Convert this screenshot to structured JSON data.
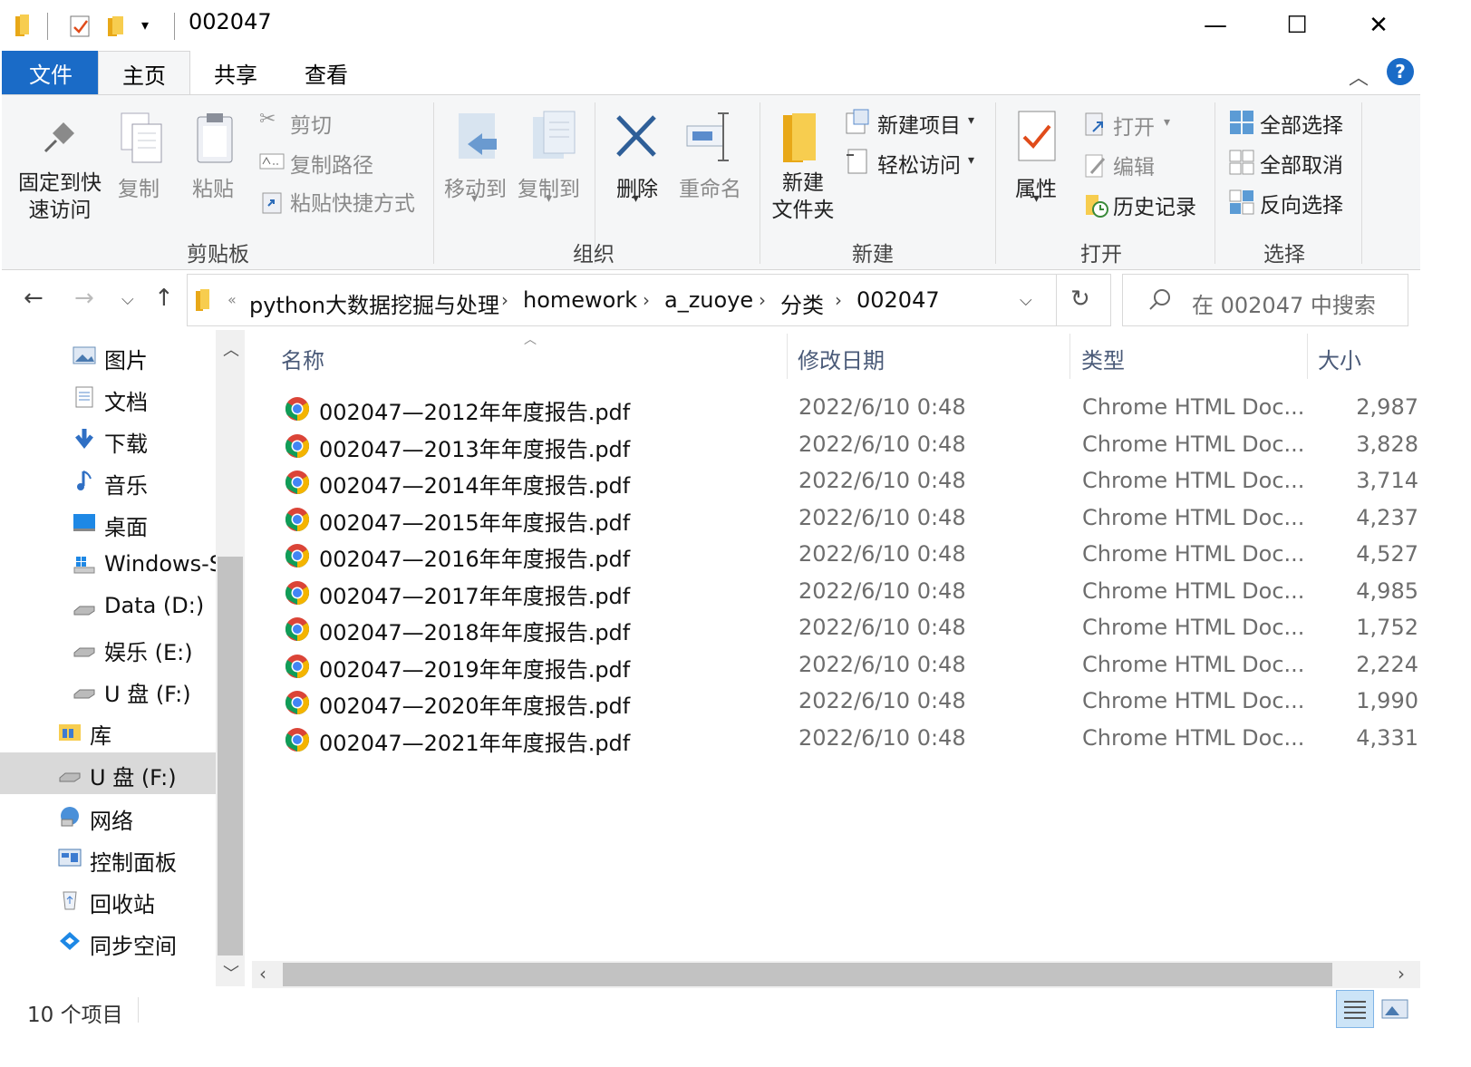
{
  "window": {
    "title": "002047",
    "controls": {
      "minimize": "—",
      "maximize": "☐",
      "close": "✕"
    }
  },
  "tabs": {
    "file": "文件",
    "home": "主页",
    "share": "共享",
    "view": "查看"
  },
  "ribbon": {
    "clipboard": {
      "pin": "固定到快\n速访问",
      "pin_l1": "固定到快",
      "pin_l2": "速访问",
      "copy": "复制",
      "paste": "粘贴",
      "cut": "剪切",
      "copy_path": "复制路径",
      "paste_shortcut": "粘贴快捷方式",
      "group": "剪贴板"
    },
    "organize": {
      "move_to": "移动到",
      "copy_to": "复制到",
      "delete": "删除",
      "rename": "重命名",
      "group": "组织"
    },
    "new": {
      "new_folder_l1": "新建",
      "new_folder_l2": "文件夹",
      "new_item": "新建项目",
      "easy_access": "轻松访问",
      "group": "新建"
    },
    "open": {
      "properties": "属性",
      "open": "打开",
      "edit": "编辑",
      "history": "历史记录",
      "group": "打开"
    },
    "select": {
      "select_all": "全部选择",
      "select_none": "全部取消",
      "invert": "反向选择",
      "group": "选择"
    }
  },
  "address": {
    "breadcrumbs": [
      "python大数据挖掘与处理",
      "homework",
      "a_zuoye",
      "分类",
      "002047"
    ],
    "search_placeholder": "在 002047 中搜索"
  },
  "nav_pane": {
    "items": [
      {
        "label": "图片",
        "icon": "pictures-icon"
      },
      {
        "label": "文档",
        "icon": "documents-icon"
      },
      {
        "label": "下载",
        "icon": "downloads-icon"
      },
      {
        "label": "音乐",
        "icon": "music-icon"
      },
      {
        "label": "桌面",
        "icon": "desktop-icon"
      },
      {
        "label": "Windows-S",
        "icon": "windows-drive-icon"
      },
      {
        "label": "Data (D:)",
        "icon": "drive-icon"
      },
      {
        "label": "娱乐 (E:)",
        "icon": "drive-icon"
      },
      {
        "label": "U 盘 (F:)",
        "icon": "usb-drive-icon"
      },
      {
        "label": "库",
        "icon": "library-icon"
      },
      {
        "label": "U 盘 (F:)",
        "icon": "usb-drive-icon"
      },
      {
        "label": "网络",
        "icon": "network-icon"
      },
      {
        "label": "控制面板",
        "icon": "control-panel-icon"
      },
      {
        "label": "回收站",
        "icon": "recycle-bin-icon"
      },
      {
        "label": "同步空间",
        "icon": "sync-space-icon"
      }
    ]
  },
  "file_list": {
    "columns": {
      "name": "名称",
      "date": "修改日期",
      "type": "类型",
      "size": "大小"
    },
    "rows": [
      {
        "name": "002047—2012年年度报告.pdf",
        "date": "2022/6/10 0:48",
        "type": "Chrome HTML Doc...",
        "size": "2,987"
      },
      {
        "name": "002047—2013年年度报告.pdf",
        "date": "2022/6/10 0:48",
        "type": "Chrome HTML Doc...",
        "size": "3,828"
      },
      {
        "name": "002047—2014年年度报告.pdf",
        "date": "2022/6/10 0:48",
        "type": "Chrome HTML Doc...",
        "size": "3,714"
      },
      {
        "name": "002047—2015年年度报告.pdf",
        "date": "2022/6/10 0:48",
        "type": "Chrome HTML Doc...",
        "size": "4,237"
      },
      {
        "name": "002047—2016年年度报告.pdf",
        "date": "2022/6/10 0:48",
        "type": "Chrome HTML Doc...",
        "size": "4,527"
      },
      {
        "name": "002047—2017年年度报告.pdf",
        "date": "2022/6/10 0:48",
        "type": "Chrome HTML Doc...",
        "size": "4,985"
      },
      {
        "name": "002047—2018年年度报告.pdf",
        "date": "2022/6/10 0:48",
        "type": "Chrome HTML Doc...",
        "size": "1,752"
      },
      {
        "name": "002047—2019年年度报告.pdf",
        "date": "2022/6/10 0:48",
        "type": "Chrome HTML Doc...",
        "size": "2,224"
      },
      {
        "name": "002047—2020年年度报告.pdf",
        "date": "2022/6/10 0:48",
        "type": "Chrome HTML Doc...",
        "size": "1,990"
      },
      {
        "name": "002047—2021年年度报告.pdf",
        "date": "2022/6/10 0:48",
        "type": "Chrome HTML Doc...",
        "size": "4,331"
      }
    ]
  },
  "status": {
    "count": "10 个项目"
  },
  "colors": {
    "accent": "#1a6bc7",
    "selected_nav": "#d9d9d9",
    "ribbon_bg": "#f5f6f7"
  }
}
